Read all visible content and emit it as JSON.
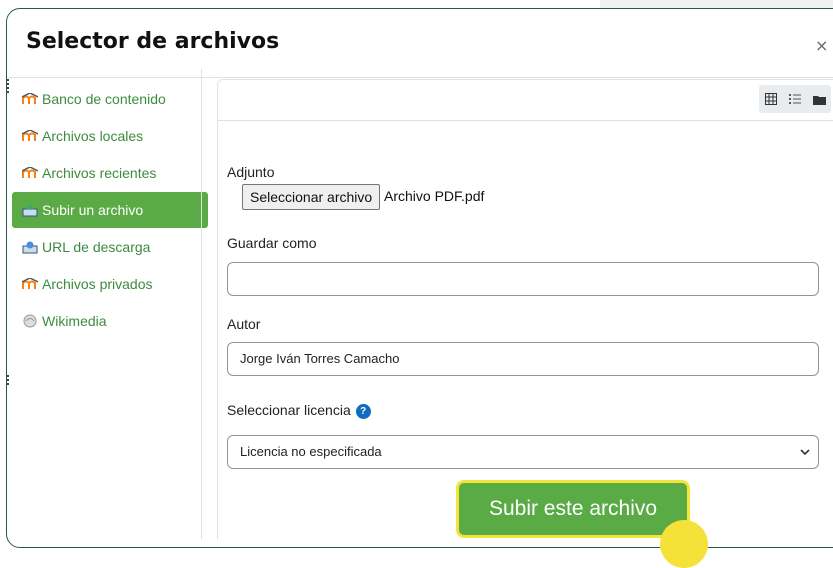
{
  "dialog": {
    "title": "Selector de archivos",
    "close_label": "×"
  },
  "sidebar": {
    "items": [
      {
        "label": "Banco de contenido",
        "icon": "moodle-icon",
        "active": false
      },
      {
        "label": "Archivos locales",
        "icon": "moodle-icon",
        "active": false
      },
      {
        "label": "Archivos recientes",
        "icon": "moodle-icon",
        "active": false
      },
      {
        "label": "Subir un archivo",
        "icon": "upload-icon",
        "active": true
      },
      {
        "label": "URL de descarga",
        "icon": "download-url-icon",
        "active": false
      },
      {
        "label": "Archivos privados",
        "icon": "moodle-icon",
        "active": false
      },
      {
        "label": "Wikimedia",
        "icon": "wikimedia-icon",
        "active": false
      }
    ]
  },
  "toolbar": {
    "views": [
      "grid-view-icon",
      "list-view-icon",
      "folder-view-icon"
    ]
  },
  "form": {
    "attachment_label": "Adjunto",
    "file_button": "Seleccionar archivo",
    "file_name": "Archivo PDF.pdf",
    "save_as_label": "Guardar como",
    "save_as_value": "",
    "author_label": "Autor",
    "author_value": "Jorge Iván Torres Camacho",
    "license_label": "Seleccionar licencia",
    "license_value": "Licencia no especificada",
    "upload_button": "Subir este archivo"
  },
  "colors": {
    "accent_green": "#5aaa45",
    "link_green": "#3c8c3f",
    "highlight_yellow": "#f3e43b",
    "help_blue": "#0f6cbf"
  }
}
